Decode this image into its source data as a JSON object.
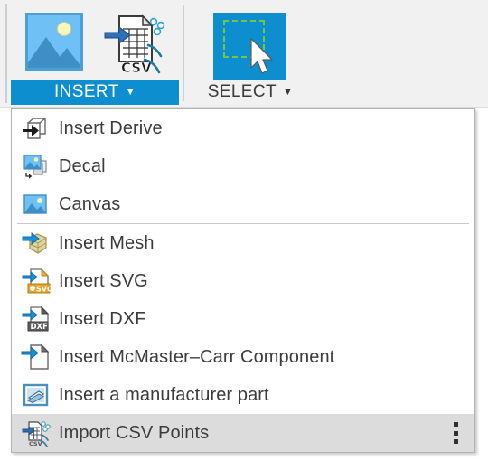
{
  "toolbar": {
    "groups": [
      {
        "caption": "INSERT",
        "active": true,
        "caret": "▼",
        "icons": [
          "image-icon",
          "csv-import-icon"
        ]
      },
      {
        "caption": "SELECT",
        "active": false,
        "caret": "▼",
        "icons": [
          "select-marquee-icon"
        ]
      }
    ]
  },
  "menu": {
    "groups": [
      {
        "items": [
          {
            "label": "Insert Derive",
            "icon": "insert-derive-icon",
            "highlighted": false
          },
          {
            "label": "Decal",
            "icon": "decal-icon",
            "highlighted": false
          },
          {
            "label": "Canvas",
            "icon": "canvas-icon",
            "highlighted": false
          }
        ]
      },
      {
        "items": [
          {
            "label": "Insert Mesh",
            "icon": "insert-mesh-icon",
            "highlighted": false
          },
          {
            "label": "Insert SVG",
            "icon": "insert-svg-icon",
            "highlighted": false
          },
          {
            "label": "Insert DXF",
            "icon": "insert-dxf-icon",
            "highlighted": false
          },
          {
            "label": "Insert McMaster–Carr Component",
            "icon": "mcmaster-carr-icon",
            "highlighted": false
          },
          {
            "label": "Insert a manufacturer part",
            "icon": "manufacturer-part-icon",
            "highlighted": false
          },
          {
            "label": "Import CSV Points",
            "icon": "import-csv-points-icon",
            "highlighted": true,
            "overflow": "more-options-kebab"
          }
        ]
      }
    ]
  },
  "colors": {
    "accent_blue": "#0d8ecf",
    "arrow_blue": "#1a8fd8",
    "highlight_gray": "#dcdcdc",
    "toolbar_bg": "#f1f1f1",
    "menu_bg": "#ffffff",
    "text": "#3c3c3c",
    "marquee_green": "#76c442",
    "svg_orange": "#e8a42a",
    "mesh_tan": "#d8cf9a"
  }
}
